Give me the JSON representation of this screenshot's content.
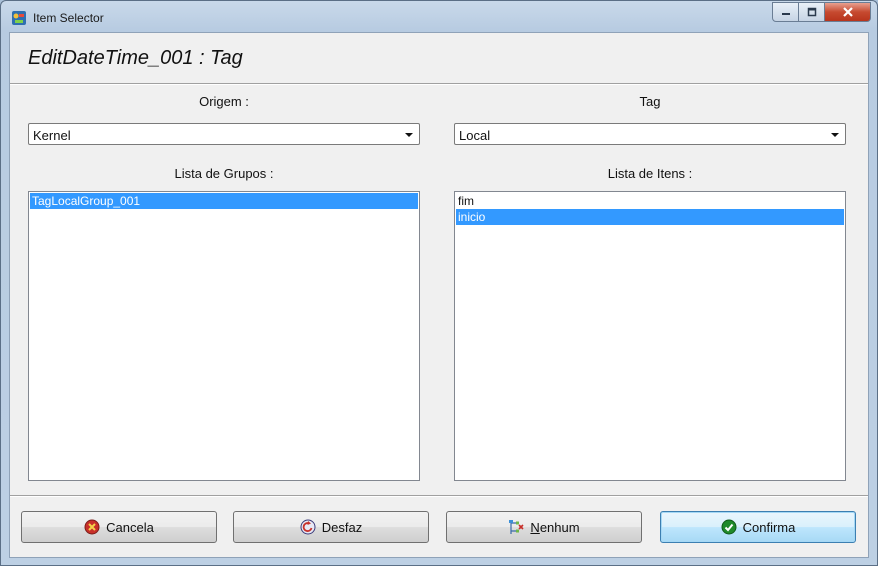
{
  "window": {
    "title": "Item Selector"
  },
  "header": {
    "title": "EditDateTime_001 : Tag"
  },
  "left": {
    "source_label": "Origem :",
    "source_value": "Kernel",
    "list_label": "Lista de Grupos :",
    "groups": [
      {
        "text": "TagLocalGroup_001",
        "selected": true
      }
    ]
  },
  "right": {
    "type_label": "Tag",
    "type_value": "Local",
    "list_label": "Lista de Itens :",
    "items": [
      {
        "text": "fim",
        "selected": false
      },
      {
        "text": "inicio",
        "selected": true
      }
    ]
  },
  "buttons": {
    "cancel": "Cancela",
    "undo": "Desfaz",
    "none_mnemonic": "N",
    "none_rest": "enhum",
    "confirm": "Confirma"
  },
  "colors": {
    "selection": "#3399ff",
    "close": "#c64a30"
  },
  "icons": {
    "app": "app-icon",
    "cancel": "cancel-icon",
    "undo": "undo-icon",
    "none": "none-icon",
    "confirm": "check-icon"
  }
}
